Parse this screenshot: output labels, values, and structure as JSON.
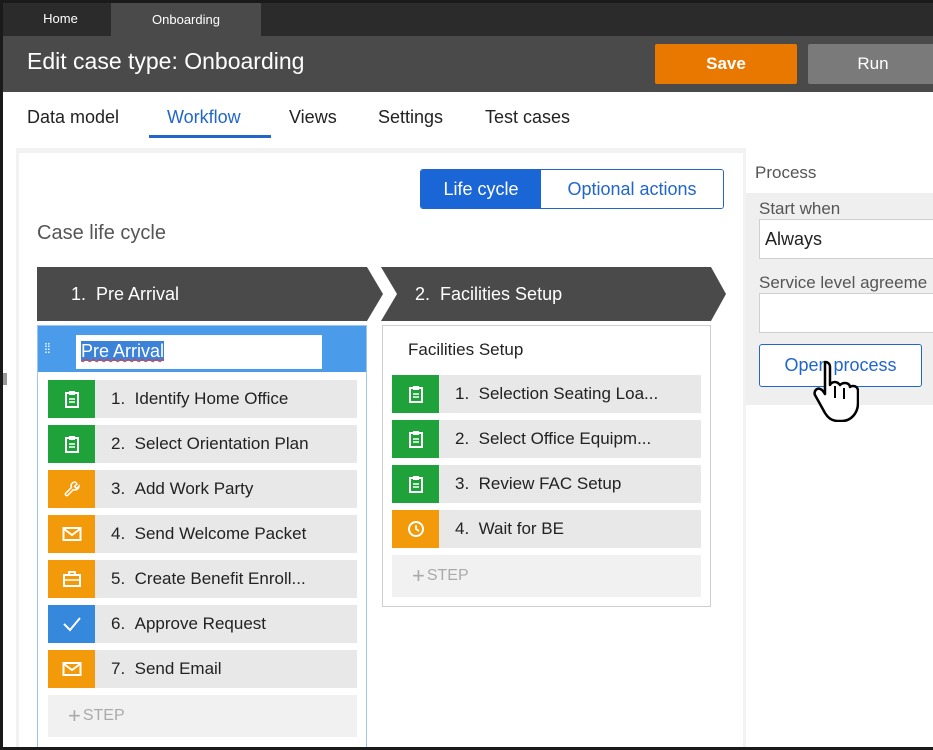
{
  "top_tabs": {
    "home": "Home",
    "onboarding": "Onboarding"
  },
  "header": {
    "title": "Edit case type: Onboarding",
    "save": "Save",
    "run": "Run"
  },
  "nav": {
    "tabs": [
      "Data model",
      "Workflow",
      "Views",
      "Settings",
      "Test cases"
    ],
    "active": "Workflow"
  },
  "toggle": {
    "life_cycle": "Life cycle",
    "optional_actions": "Optional actions",
    "active": "Life cycle"
  },
  "lifecycle_title": "Case life cycle",
  "stages": [
    {
      "number": "1.",
      "name": "Pre Arrival",
      "editing_value": "Pre Arrival",
      "steps": [
        {
          "num": "1.",
          "label": "Identify Home Office",
          "icon": "clipboard-icon",
          "color": "#1fa23a"
        },
        {
          "num": "2.",
          "label": "Select Orientation Plan",
          "icon": "clipboard-icon",
          "color": "#1fa23a"
        },
        {
          "num": "3.",
          "label": "Add Work Party",
          "icon": "wrench-icon",
          "color": "#f39a0a"
        },
        {
          "num": "4.",
          "label": "Send Welcome Packet",
          "icon": "envelope-icon",
          "color": "#f39a0a"
        },
        {
          "num": "5.",
          "label": "Create Benefit Enroll...",
          "icon": "briefcase-icon",
          "color": "#f39a0a"
        },
        {
          "num": "6.",
          "label": "Approve Request",
          "icon": "checkmark-icon",
          "color": "#3688dc"
        },
        {
          "num": "7.",
          "label": "Send Email",
          "icon": "envelope-icon",
          "color": "#f39a0a"
        }
      ],
      "add_step": "STEP"
    },
    {
      "number": "2.",
      "name": "Facilities Setup",
      "process_name": "Facilities Setup",
      "steps": [
        {
          "num": "1.",
          "label": "Selection Seating Loa...",
          "icon": "clipboard-icon",
          "color": "#1fa23a"
        },
        {
          "num": "2.",
          "label": "Select Office Equipm...",
          "icon": "clipboard-icon",
          "color": "#1fa23a"
        },
        {
          "num": "3.",
          "label": "Review FAC Setup",
          "icon": "clipboard-icon",
          "color": "#1fa23a"
        },
        {
          "num": "4.",
          "label": "Wait for BE",
          "icon": "clock-icon",
          "color": "#f39a0a"
        }
      ],
      "add_step": "STEP"
    }
  ],
  "panel": {
    "title": "Process",
    "start_when_label": "Start when",
    "start_when_value": "Always",
    "sla_label": "Service level agreeme",
    "sla_value": "",
    "open_process": "Open process"
  }
}
